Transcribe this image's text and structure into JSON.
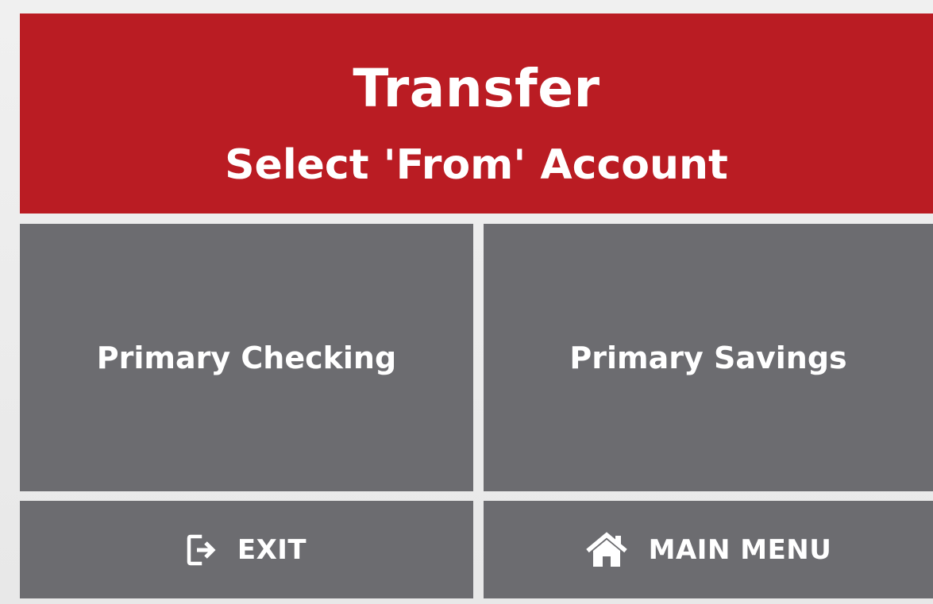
{
  "header": {
    "title": "Transfer",
    "subtitle": "Select 'From' Account"
  },
  "accounts": [
    {
      "label": "Primary Checking"
    },
    {
      "label": "Primary Savings"
    }
  ],
  "nav": {
    "exit": {
      "label": "EXIT",
      "icon": "exit-icon"
    },
    "main_menu": {
      "label": "MAIN MENU",
      "icon": "home-icon"
    }
  },
  "colors": {
    "header_bg": "#ba1c23",
    "tile_bg": "#6c6c70",
    "text": "#ffffff",
    "page_bg": "#ececec"
  }
}
